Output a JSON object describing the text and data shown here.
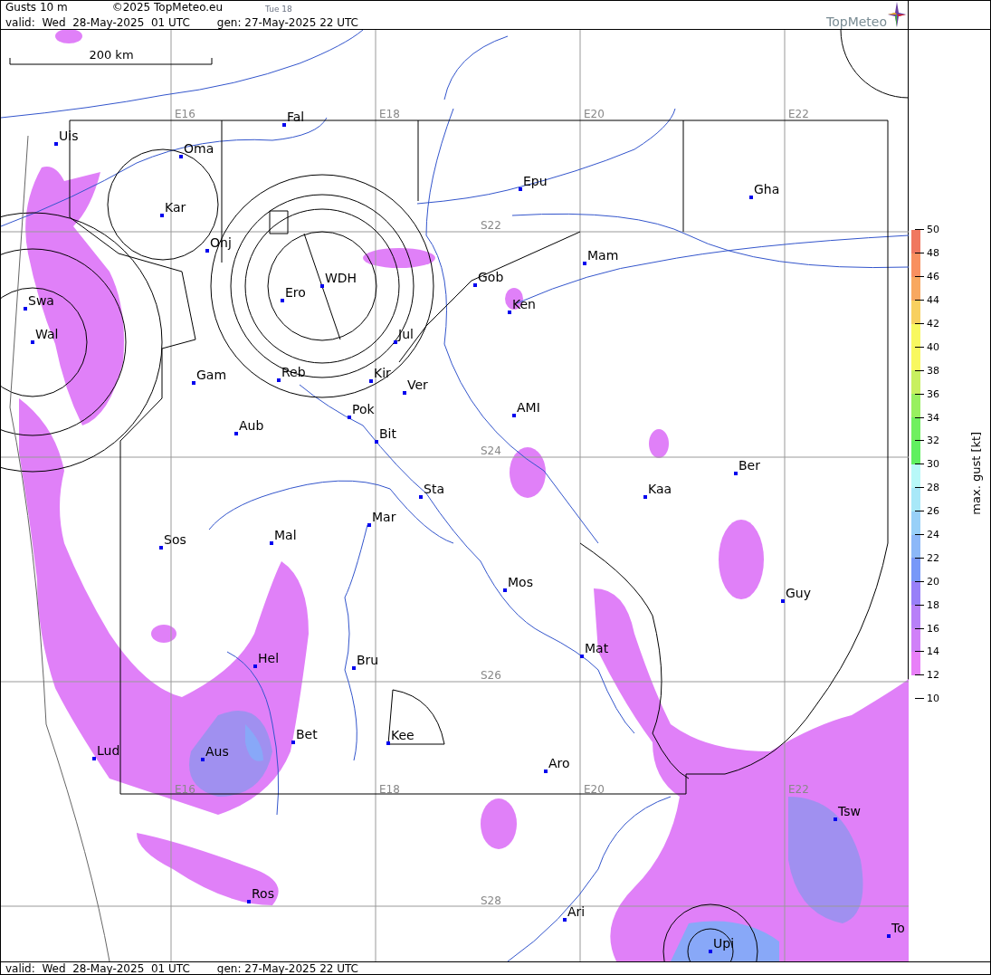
{
  "header": {
    "title": "Gusts 10 m",
    "copyright": "©2025 TopMeteo.eu",
    "day": "Tue 18",
    "valid": "valid:  Wed  28-May-2025  01 UTC",
    "generated": "gen: 27-May-2025 22 UTC",
    "logo": "TopMeteo"
  },
  "map": {
    "scale_label": "200 km",
    "grid_labels": [
      "E16",
      "E18",
      "E20",
      "E22",
      "S22",
      "S24",
      "S26",
      "S28",
      "E16",
      "E18",
      "E20",
      "E22"
    ],
    "places": [
      {
        "name": "Uis"
      },
      {
        "name": "Fal"
      },
      {
        "name": "Oma"
      },
      {
        "name": "Kar"
      },
      {
        "name": "Onj"
      },
      {
        "name": "Swa"
      },
      {
        "name": "Wal"
      },
      {
        "name": "WDH"
      },
      {
        "name": "Ero"
      },
      {
        "name": "Jul"
      },
      {
        "name": "Gob"
      },
      {
        "name": "Mam"
      },
      {
        "name": "Ken"
      },
      {
        "name": "Epu"
      },
      {
        "name": "Gha"
      },
      {
        "name": "Gam"
      },
      {
        "name": "Reb"
      },
      {
        "name": "Kir"
      },
      {
        "name": "Ver"
      },
      {
        "name": "Pok"
      },
      {
        "name": "Bit"
      },
      {
        "name": "AMI"
      },
      {
        "name": "Aub"
      },
      {
        "name": "Sta"
      },
      {
        "name": "Mar"
      },
      {
        "name": "Kaa"
      },
      {
        "name": "Ber"
      },
      {
        "name": "Sos"
      },
      {
        "name": "Mal"
      },
      {
        "name": "Mos"
      },
      {
        "name": "Guy"
      },
      {
        "name": "Mat"
      },
      {
        "name": "Hel"
      },
      {
        "name": "Bru"
      },
      {
        "name": "Bet"
      },
      {
        "name": "Kee"
      },
      {
        "name": "Lud"
      },
      {
        "name": "Aus"
      },
      {
        "name": "Aro"
      },
      {
        "name": "Tsw"
      },
      {
        "name": "Ros"
      },
      {
        "name": "Ari"
      },
      {
        "name": "Upi"
      },
      {
        "name": "To"
      }
    ]
  },
  "legend": {
    "title": "max. gust [kt]",
    "bands": [
      {
        "color": "#f07860"
      },
      {
        "color": "#f89060"
      },
      {
        "color": "#f8a860"
      },
      {
        "color": "#f8d060"
      },
      {
        "color": "#f8f860"
      },
      {
        "color": "#f8f860"
      },
      {
        "color": "#c8f060"
      },
      {
        "color": "#98f060"
      },
      {
        "color": "#70f060"
      },
      {
        "color": "#60f060"
      },
      {
        "color": "#b8f8f8"
      },
      {
        "color": "#a8e8f8"
      },
      {
        "color": "#98d0f8"
      },
      {
        "color": "#8cb8f8"
      },
      {
        "color": "#7898f8"
      },
      {
        "color": "#9880f8"
      },
      {
        "color": "#b880f8"
      },
      {
        "color": "#d080f8"
      },
      {
        "color": "#e880f8"
      }
    ],
    "ticks": [
      "50",
      "48",
      "46",
      "44",
      "42",
      "40",
      "38",
      "36",
      "34",
      "32",
      "30",
      "28",
      "26",
      "24",
      "22",
      "20",
      "18",
      "16",
      "14",
      "12",
      "10"
    ]
  },
  "footer": {
    "valid": "valid:  Wed  28-May-2025  01 UTC",
    "generated": "gen: 27-May-2025 22 UTC"
  }
}
